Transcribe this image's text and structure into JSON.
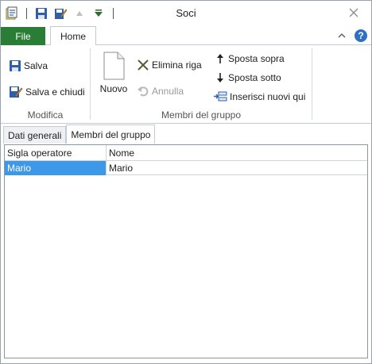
{
  "window": {
    "title": "Soci"
  },
  "qat": {
    "items": [
      {
        "icon": "open-icon"
      },
      {
        "icon": "save-icon"
      },
      {
        "icon": "edit-icon"
      },
      {
        "icon": "triangle-up-icon"
      },
      {
        "icon": "triangle-down-icon"
      }
    ]
  },
  "ribbon": {
    "file_tab": "File",
    "home_tab": "Home",
    "groups": {
      "modifica": {
        "label": "Modifica",
        "salva": "Salva",
        "salva_chiudi": "Salva e chiudi"
      },
      "membri": {
        "label": "Membri del gruppo",
        "nuovo": "Nuovo",
        "elimina_riga": "Elimina riga",
        "annulla": "Annulla",
        "sposta_sopra": "Sposta sopra",
        "sposta_sotto": "Sposta sotto",
        "inserisci_nuovi": "Inserisci nuovi qui"
      }
    }
  },
  "content": {
    "tabs": [
      {
        "label": "Dati generali",
        "active": false
      },
      {
        "label": "Membri del gruppo",
        "active": true
      }
    ],
    "grid": {
      "columns": [
        "Sigla operatore",
        "Nome"
      ],
      "rows": [
        [
          "Mario",
          "Mario"
        ]
      ]
    }
  },
  "colors": {
    "file_tab": "#2a7d34",
    "selection": "#3e98e8",
    "help": "#2f6fc4"
  }
}
